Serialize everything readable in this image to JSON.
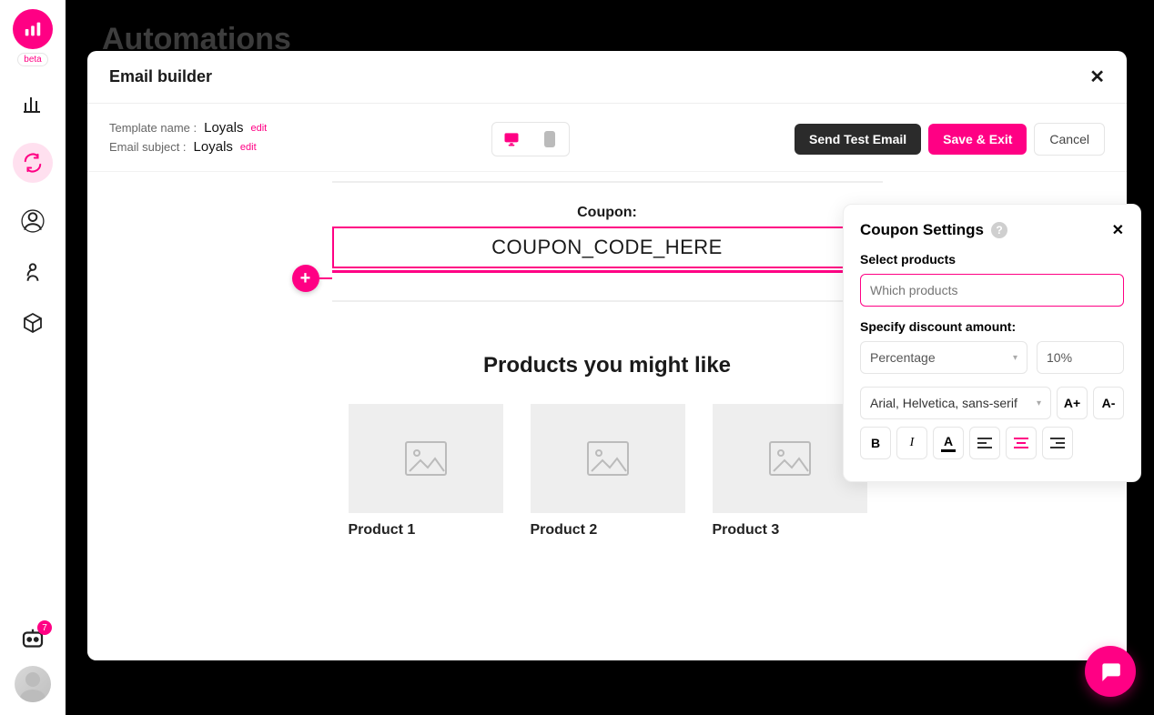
{
  "sidebar": {
    "beta_label": "beta",
    "bot_notification_count": "7"
  },
  "page": {
    "title": "Automations"
  },
  "modal": {
    "title": "Email builder",
    "template_name_label": "Template name :",
    "template_name_value": "Loyals",
    "email_subject_label": "Email subject :",
    "email_subject_value": "Loyals",
    "edit_label": "edit",
    "send_test_label": "Send Test Email",
    "save_exit_label": "Save & Exit",
    "cancel_label": "Cancel"
  },
  "email": {
    "coupon_label": "Coupon:",
    "coupon_code": "COUPON_CODE_HERE",
    "products_title": "Products you might like",
    "products": [
      {
        "name": "Product 1"
      },
      {
        "name": "Product 2"
      },
      {
        "name": "Product 3"
      }
    ]
  },
  "panel": {
    "title": "Coupon Settings",
    "select_products_label": "Select products",
    "select_products_placeholder": "Which products",
    "discount_label": "Specify discount amount:",
    "discount_type": "Percentage",
    "discount_value": "10%",
    "font_family": "Arial, Helvetica, sans-serif",
    "font_inc": "A+",
    "font_dec": "A-",
    "bold": "B",
    "italic": "I",
    "color": "A"
  }
}
